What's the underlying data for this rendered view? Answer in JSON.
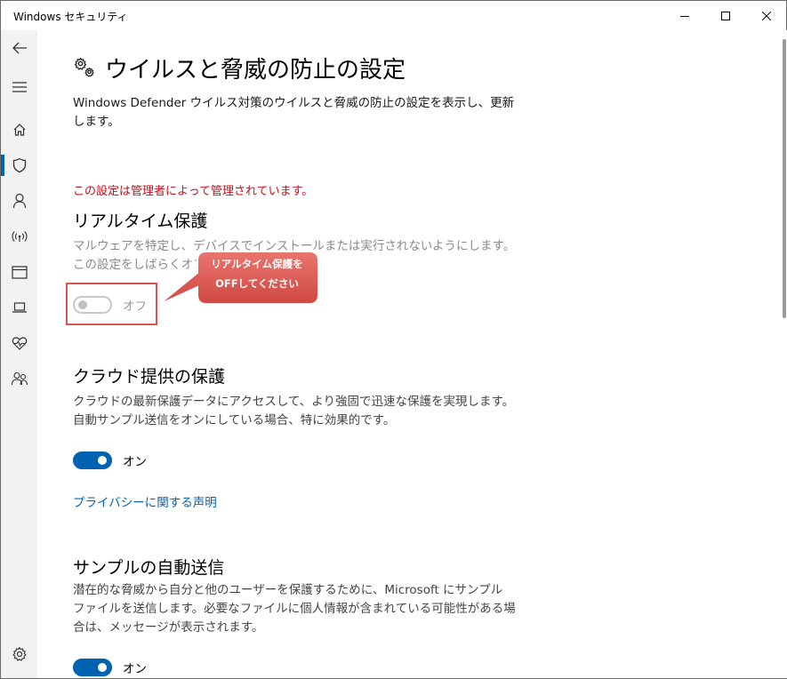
{
  "window": {
    "title": "Windows セキュリティ"
  },
  "page": {
    "title": "ウイルスと脅威の防止の設定",
    "description": "Windows Defender ウイルス対策のウイルスと脅威の防止の設定を表示し、更新します。",
    "admin_warning": "この設定は管理者によって管理されています。"
  },
  "sections": {
    "realtime": {
      "title": "リアルタイム保護",
      "description": "マルウェアを特定し、デバイスでインストールまたは実行されないようにします。この設定をしばらくオフにすると、自",
      "toggle_label": "オフ",
      "toggle_on": false
    },
    "cloud": {
      "title": "クラウド提供の保護",
      "description": "クラウドの最新保護データにアクセスして、より強固で迅速な保護を実現します。自動サンプル送信をオンにしている場合、特に効果的です。",
      "toggle_label": "オン",
      "toggle_on": true,
      "link": "プライバシーに関する声明"
    },
    "sample": {
      "title": "サンプルの自動送信",
      "description": "潜在的な脅威から自分と他のユーザーを保護するために、Microsoft にサンプル ファイルを送信します。必要なファイルに個人情報が含まれている可能性がある場合は、メッセージが表示されます。",
      "toggle_label": "オン",
      "toggle_on": true
    }
  },
  "callout": {
    "line1": "リアルタイム保護を",
    "line2": "OFFしてください"
  },
  "nav": {
    "items": [
      "back-arrow-icon",
      "hamburger-menu-icon",
      "home-icon",
      "shield-icon",
      "person-icon",
      "wireless-icon",
      "browser-window-icon",
      "laptop-icon",
      "heart-pulse-icon",
      "family-icon",
      "gear-icon"
    ],
    "active": "shield-icon"
  },
  "colors": {
    "accent": "#0063b1",
    "warning": "#c50f1f",
    "callout": "#d9534f"
  }
}
